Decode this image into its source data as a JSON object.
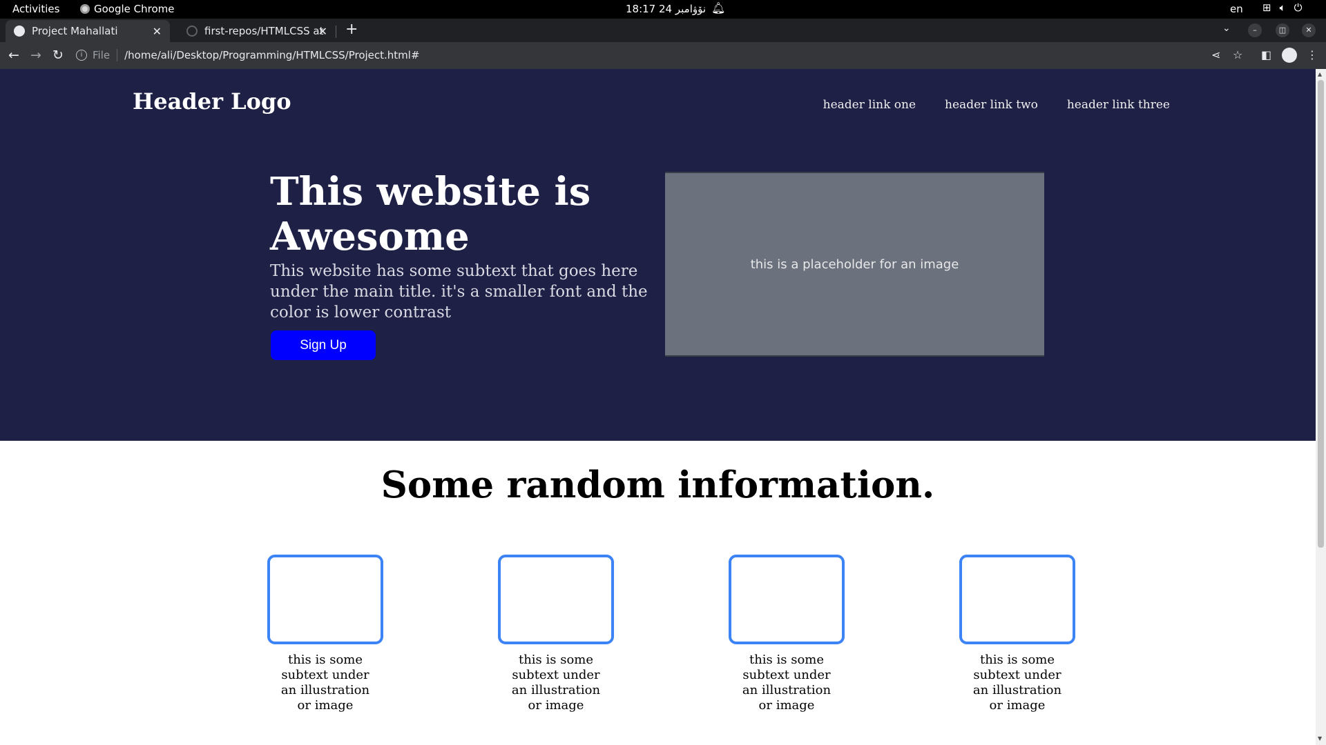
{
  "system": {
    "activities": "Activities",
    "app_name": "Google Chrome",
    "clock": "18:17  24 نۆۋامبر",
    "lang": "en"
  },
  "browser": {
    "tabs": [
      {
        "title": "Project Mahallati",
        "active": true
      },
      {
        "title": "first-repos/HTMLCSS at m",
        "active": false
      }
    ],
    "address": {
      "scheme_label": "File",
      "url": "/home/ali/Desktop/Programming/HTMLCSS/Project.html#"
    }
  },
  "page": {
    "header": {
      "logo": "Header Logo",
      "links": [
        "header link one",
        "header link two",
        "header link three"
      ]
    },
    "hero": {
      "title": "This website is Awesome",
      "subtext": "This website has some subtext that goes here under the main title. it's a smaller font and the color is lower contrast",
      "button": "Sign Up",
      "image_placeholder": "this is a placeholder for an image"
    },
    "info": {
      "title": "Some random information.",
      "cards": [
        {
          "caption": "this is some subtext under an illustration or image"
        },
        {
          "caption": "this is some subtext under an illustration or image"
        },
        {
          "caption": "this is some subtext under an illustration or image"
        },
        {
          "caption": "this is some subtext under an illustration or image"
        }
      ]
    }
  },
  "colors": {
    "hero_bg": "#1f2046",
    "button_bg": "#0000ff",
    "card_border": "#3c84f5",
    "placeholder_bg": "#6b727d"
  }
}
